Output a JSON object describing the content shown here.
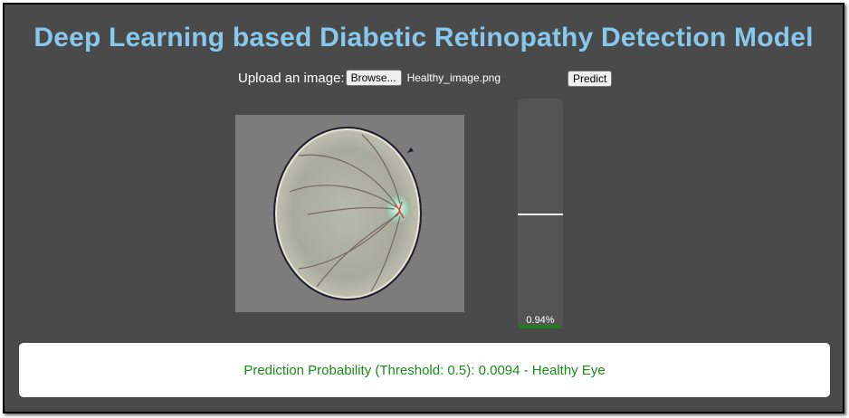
{
  "title": "Deep Learning based Diabetic Retinopathy Detection Model",
  "upload": {
    "label": "Upload an image:",
    "browse_label": "Browse...",
    "file_name": "Healthy_image.png"
  },
  "predict_label": "Predict",
  "gauge": {
    "value_text": "0.94%",
    "probability": 0.0094,
    "threshold": 0.5,
    "fill_color": "#1e7f1e"
  },
  "result_text": "Prediction Probability (Threshold: 0.5): 0.0094 - Healthy Eye",
  "colors": {
    "title": "#87c8ec",
    "background": "#4a4a4a",
    "result": "#1a8a1a"
  }
}
